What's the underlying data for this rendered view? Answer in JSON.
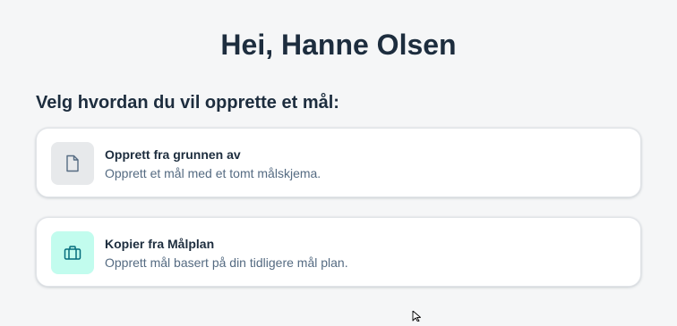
{
  "header": {
    "greeting": "Hei, Hanne Olsen"
  },
  "main": {
    "prompt": "Velg hvordan du vil opprette et mål:",
    "options": [
      {
        "title": "Opprett fra grunnen av",
        "description": "Opprett et mål med et tomt målskjema.",
        "icon": "document-icon",
        "icon_bg": "#e7e9eb",
        "icon_color": "#556b82"
      },
      {
        "title": "Kopier fra Målplan",
        "description": "Opprett mål basert på din tidligere mål plan.",
        "icon": "briefcase-icon",
        "icon_bg": "#c2fcee",
        "icon_color": "#046c7c"
      }
    ]
  }
}
